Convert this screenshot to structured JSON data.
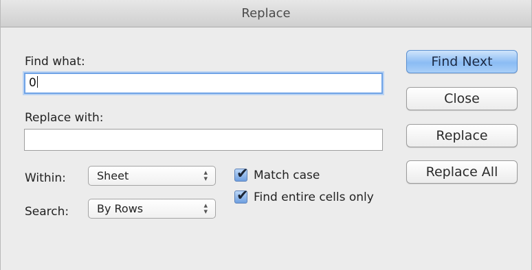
{
  "window": {
    "title": "Replace"
  },
  "find": {
    "label": "Find what:",
    "value": "0"
  },
  "replace": {
    "label": "Replace with:",
    "value": ""
  },
  "within": {
    "label": "Within:",
    "value": "Sheet"
  },
  "search": {
    "label": "Search:",
    "value": "By Rows"
  },
  "options": {
    "match_case": {
      "label": "Match case",
      "checked": true
    },
    "entire_cells": {
      "label": "Find entire cells only",
      "checked": true
    }
  },
  "buttons": {
    "find_next": "Find Next",
    "close": "Close",
    "replace": "Replace",
    "replace_all": "Replace All"
  },
  "icons": {
    "select_arrows": "up-down-chevron-icon",
    "checkmark": "checkmark-icon"
  },
  "colors": {
    "default_button": "#8bbcf4",
    "focus_ring": "#6fa3e6",
    "checkbox": "#6f9fe0"
  }
}
